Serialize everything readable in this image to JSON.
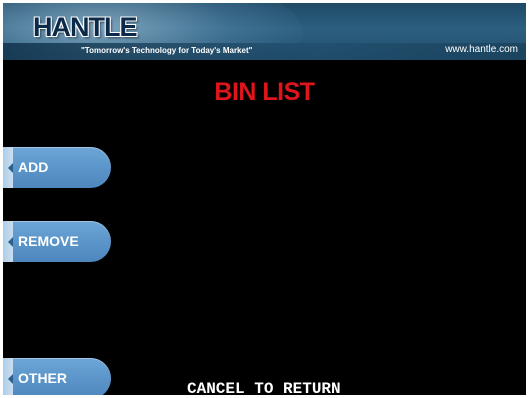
{
  "header": {
    "logo_text": "HANTLE",
    "slogan": "\"Tomorrow's Technology for Today's Market\"",
    "website": "www.hantle.com"
  },
  "screen": {
    "title": "BIN LIST",
    "footer": "CANCEL TO RETURN"
  },
  "buttons": {
    "add_label": "ADD",
    "remove_label": "REMOVE",
    "other_label": "OTHER"
  },
  "colors": {
    "title": "#e0141b",
    "button": "#5b95c9",
    "background": "#000000",
    "header": "#2c5f80"
  }
}
